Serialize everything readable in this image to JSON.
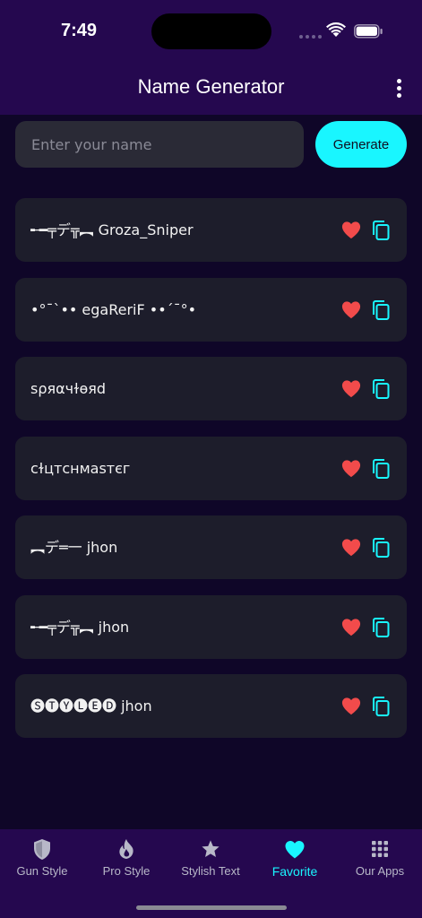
{
  "status_bar": {
    "time": "7:49"
  },
  "header": {
    "title": "Name Generator"
  },
  "input": {
    "placeholder": "Enter your name",
    "value": ""
  },
  "generate_label": "Generate",
  "items": [
    {
      "name": "╾━╤デ╦︻ Groza_Sniper"
    },
    {
      "name": "•°¯`•• egaReriF ••´¯°•"
    },
    {
      "name": "ѕρяαчɫɵяd"
    },
    {
      "name": "cɫцтcнмaѕтєг"
    },
    {
      "name": "︻デ═一 jhon"
    },
    {
      "name": "╾━╤デ╦︻ jhon"
    },
    {
      "name": "🅢🅣🅨🅛🅔🅓 jhon"
    }
  ],
  "nav": [
    {
      "label": "Gun Style",
      "icon": "shield-icon"
    },
    {
      "label": "Pro Style",
      "icon": "flame-icon"
    },
    {
      "label": "Stylish Text",
      "icon": "star-icon"
    },
    {
      "label": "Favorite",
      "icon": "heart-icon"
    },
    {
      "label": "Our Apps",
      "icon": "grid-icon"
    }
  ],
  "colors": {
    "accent": "#19f6ff",
    "header_bg": "#25084f",
    "page_bg": "#0f0628",
    "card_bg": "#1d1d2b",
    "heart": "#f24b4b"
  }
}
